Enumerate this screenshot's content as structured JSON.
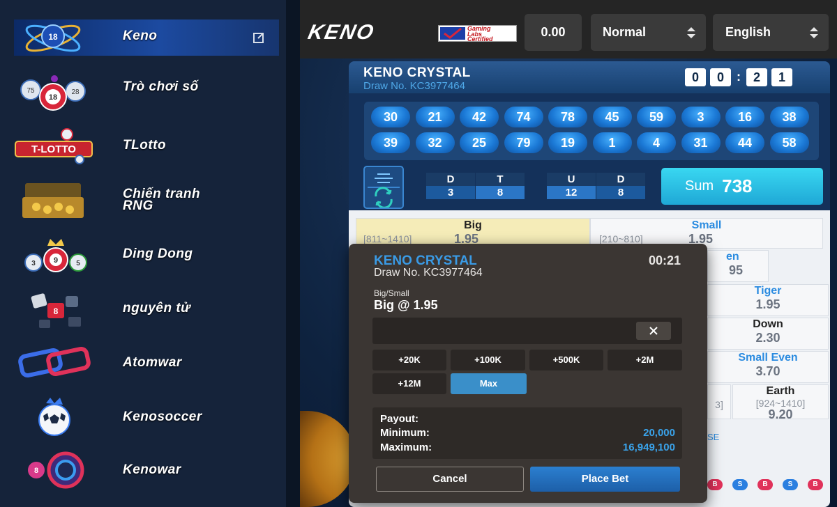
{
  "sidebar": {
    "items": [
      {
        "label": "Keno",
        "icon": "keno-atom-icon"
      },
      {
        "label": "Trò chơi số",
        "icon": "lottery-balls-icon"
      },
      {
        "label": "TLotto",
        "icon": "tlotto-icon"
      },
      {
        "label": "Chiến tranh RNG",
        "icon": "treasure-chest-icon"
      },
      {
        "label": "Ding Dong",
        "icon": "ding-dong-balls-icon"
      },
      {
        "label": "nguyên tử",
        "icon": "dice-tiles-icon"
      },
      {
        "label": "Atomwar",
        "icon": "chain-link-icon"
      },
      {
        "label": "Kenosoccer",
        "icon": "soccer-ball-icon"
      },
      {
        "label": "Kenowar",
        "icon": "target-icon"
      }
    ]
  },
  "header": {
    "logo": "KENO",
    "certified": {
      "line1": "Gaming",
      "line2": "Labs",
      "line3": "Certified"
    },
    "balance": "0.00",
    "mode": "Normal",
    "language": "English"
  },
  "panel": {
    "title": "KENO CRYSTAL",
    "draw_no": "Draw No. KC3977464",
    "timer": [
      "0",
      "0",
      ":",
      "2",
      "1"
    ],
    "balls_row1": [
      "30",
      "21",
      "42",
      "74",
      "78",
      "45",
      "59",
      "3",
      "16",
      "38"
    ],
    "balls_row2": [
      "39",
      "32",
      "25",
      "79",
      "19",
      "1",
      "4",
      "31",
      "44",
      "58"
    ],
    "dt": {
      "d_label": "D",
      "d_value": "3",
      "t_label": "T",
      "t_value": "8"
    },
    "ud": {
      "u_label": "U",
      "u_value": "12",
      "d_label": "D",
      "d_value": "8"
    },
    "sum_label": "Sum",
    "sum_value": "738"
  },
  "odds": {
    "big": {
      "name": "Big",
      "range": "[811~1410]",
      "value": "1.95"
    },
    "small": {
      "name": "Small",
      "range": "[210~810]",
      "value": "1.95"
    },
    "even_partial": {
      "name": "en",
      "value": "95"
    },
    "tiger": {
      "name": "Tiger",
      "value": "1.95"
    },
    "down": {
      "name": "Down",
      "value": "2.30"
    },
    "small_even": {
      "name": "Small Even",
      "value": "3.70"
    },
    "earth": {
      "name": "Earth",
      "range": "[924~1410]",
      "value": "9.20"
    },
    "partial_range": "3]",
    "se_fragment": "SE"
  },
  "popup": {
    "title": "KENO CRYSTAL",
    "draw_no": "Draw No. KC3977464",
    "timer": "00:21",
    "bet_type": "Big/Small",
    "selection": "Big @ 1.95",
    "amount_value": "",
    "chips": [
      "+20K",
      "+100K",
      "+500K",
      "+2M",
      "+12M",
      "Max"
    ],
    "payout_label": "Payout:",
    "min_label": "Minimum:",
    "min_value": "20,000",
    "max_label": "Maximum:",
    "max_value": "16,949,100",
    "cancel": "Cancel",
    "place": "Place Bet"
  },
  "history_chips": [
    "B",
    "S",
    "B",
    "S",
    "B",
    "S"
  ],
  "colors": {
    "accent_blue": "#3a9be6",
    "sum_cyan": "#2fc3e8",
    "big_highlight": "#f5ecb8",
    "popup_bg": "#3b3633"
  }
}
